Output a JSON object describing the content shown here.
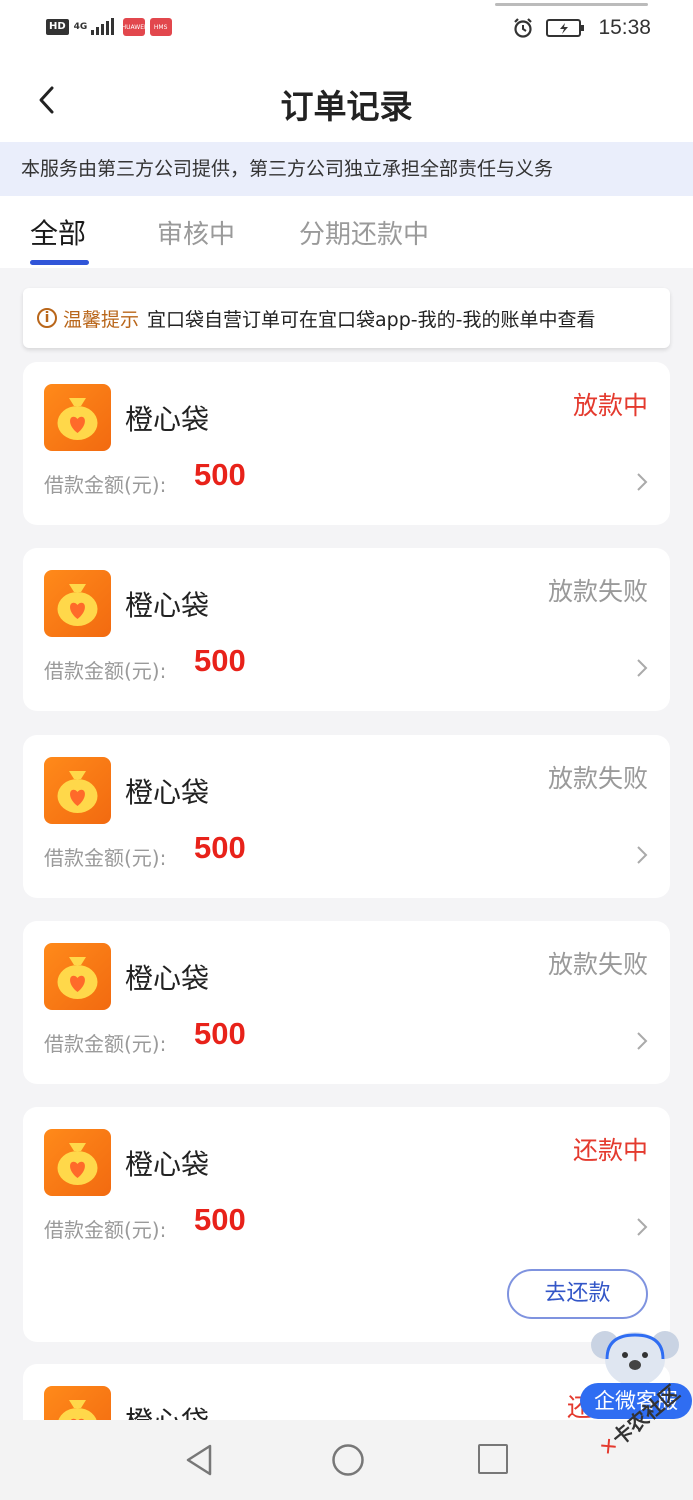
{
  "status_bar": {
    "hd": "HD",
    "network": "4G",
    "app_icon_1": "HUAWEI",
    "app_icon_2": "HMS",
    "time": "15:38",
    "icons": [
      "alarm-icon",
      "battery-charging-icon"
    ]
  },
  "header": {
    "title": "订单记录",
    "back_icon": "chevron-left-icon"
  },
  "notice": {
    "text": "本服务由第三方公司提供，第三方公司独立承担全部责任与义务"
  },
  "tabs": [
    {
      "label": "全部",
      "active": true
    },
    {
      "label": "审核中",
      "active": false
    },
    {
      "label": "分期还款中",
      "active": false
    }
  ],
  "tip": {
    "label": "温馨提示",
    "text": "宜口袋自营订单可在宜口袋app-我的-我的账单中查看"
  },
  "orders": [
    {
      "name": "橙心袋",
      "status": "放款中",
      "status_color": "#e43a2e",
      "amount_label": "借款金额(元):",
      "amount": "500"
    },
    {
      "name": "橙心袋",
      "status": "放款失败",
      "status_color": "#9a9a9a",
      "amount_label": "借款金额(元):",
      "amount": "500"
    },
    {
      "name": "橙心袋",
      "status": "放款失败",
      "status_color": "#9a9a9a",
      "amount_label": "借款金额(元):",
      "amount": "500"
    },
    {
      "name": "橙心袋",
      "status": "放款失败",
      "status_color": "#9a9a9a",
      "amount_label": "借款金额(元):",
      "amount": "500"
    },
    {
      "name": "橙心袋",
      "status": "还款中",
      "status_color": "#e43a2e",
      "amount_label": "借款金额(元):",
      "amount": "500",
      "action": "去还款"
    },
    {
      "name": "橙心袋",
      "status": "还",
      "status_color": "#e43a2e"
    }
  ],
  "customer_service": {
    "label": "企微客服"
  },
  "watermark": {
    "text": "卡农社区"
  },
  "colors": {
    "accent": "#3055d8",
    "price": "#e8221a",
    "brand_orange": "#f26a10",
    "notice_bg": "#eaeefb",
    "tip_label": "#b9661a"
  }
}
